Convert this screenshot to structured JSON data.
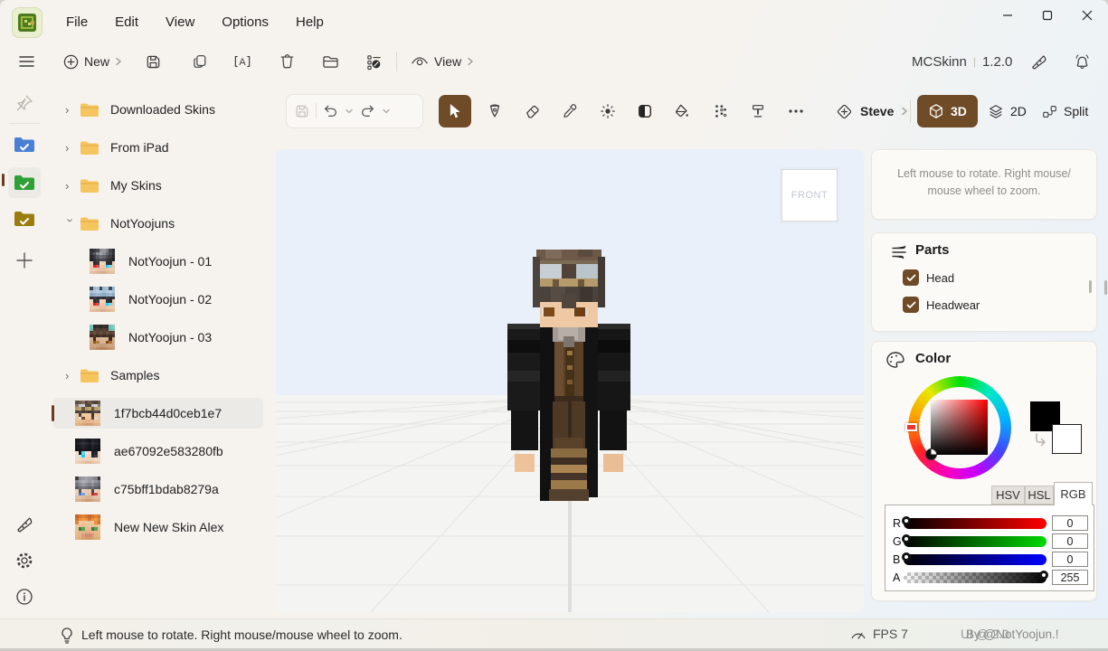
{
  "window": {
    "title": "MCSkinn",
    "title_sep": "|",
    "version": "1.2.0"
  },
  "menu": {
    "items": [
      "File",
      "Edit",
      "View",
      "Options",
      "Help"
    ]
  },
  "toolbar": {
    "new_label": "New",
    "view_label": "View"
  },
  "editor": {
    "model_label": "Steve",
    "mode_3d": "3D",
    "mode_2d": "2D",
    "mode_split": "Split"
  },
  "viewport": {
    "front_label": "FRONT"
  },
  "panels": {
    "tip": "Left mouse to rotate. Right mouse/ mouse wheel to zoom.",
    "parts": {
      "title": "Parts",
      "items": [
        {
          "label": "Head",
          "checked": true
        },
        {
          "label": "Headwear",
          "checked": true
        }
      ]
    },
    "color": {
      "title": "Color",
      "tabs": [
        "HSV",
        "HSL",
        "RGB"
      ],
      "active_tab": "RGB",
      "channels": [
        {
          "label": "R",
          "value": "0",
          "track": "tr-r",
          "thumb_at_end": false
        },
        {
          "label": "G",
          "value": "0",
          "track": "tr-g",
          "thumb_at_end": false
        },
        {
          "label": "B",
          "value": "0",
          "track": "tr-b",
          "thumb_at_end": false
        },
        {
          "label": "A",
          "value": "255",
          "track": "tr-a",
          "thumb_at_end": true
        }
      ],
      "primary_swatch": "#000000",
      "secondary_swatch": "#ffffff"
    }
  },
  "status": {
    "tip": "Left mouse to rotate. Right mouse/mouse wheel to zoom.",
    "fps_label": "FPS",
    "fps_value": "7",
    "credit_back": "UI @ 2.0",
    "credit_front": "By @NotYoojun.!"
  },
  "colors": {
    "accent_brown": "#6f4b27",
    "folder_yellow": "#f5c65f",
    "folder_tab": "#e8b04a",
    "rail_blue": "#4b7fd6",
    "rail_green": "#2fa035",
    "rail_olive": "#9a7d0e",
    "sky": "#e9f0f9",
    "floor": "#f4f4f2",
    "selection_bg": "#eceae6",
    "selection_bar": "#6b3a20"
  },
  "tree": {
    "rows": [
      {
        "kind": "folder",
        "label": "Downloaded Skins",
        "expanded": false
      },
      {
        "kind": "folder",
        "label": "From iPad",
        "expanded": false
      },
      {
        "kind": "folder",
        "label": "My Skins",
        "expanded": false
      },
      {
        "kind": "folder",
        "label": "NotYoojuns",
        "expanded": true
      },
      {
        "kind": "skin",
        "label": "NotYoojun - 01",
        "thumb": "t01",
        "child": true
      },
      {
        "kind": "skin",
        "label": "NotYoojun - 02",
        "thumb": "t02",
        "child": true
      },
      {
        "kind": "skin",
        "label": "NotYoojun - 03",
        "thumb": "t03",
        "child": true
      },
      {
        "kind": "folder",
        "label": "Samples",
        "expanded": false
      },
      {
        "kind": "skin",
        "label": "1f7bcb44d0ceb1e7",
        "thumb": "t1f",
        "selected": true
      },
      {
        "kind": "skin",
        "label": "ae67092e583280fb",
        "thumb": "tae"
      },
      {
        "kind": "skin",
        "label": "c75bff1bdab8279a",
        "thumb": "tc7"
      },
      {
        "kind": "skin",
        "label": "New New Skin Alex",
        "thumb": "tal"
      }
    ]
  },
  "thumbs": {
    "t01": [
      "#2f2f33 #3b3b3f #4a4a4e #8d8d93 #9a9aa1 #7e7e85 #44444a #2c2c30",
      "#3a3a3e #55555b #8a8a91 #a3a3ab #8f8f97 #6b6b73 #4c4c52 #333337",
      "#2b2b2f #3e3e44 #5a5a61 #72727a #63636b #4e4e55 #3a3a40 #292a2e",
      "#232327 #2f2f35 #3f3f46 #4c4c53 #45454c #38383f #2d2d33 #212125",
      "#f0d7bd #2e2e32 #3a3a3e #f0d7bd #edd2b8 #323236 #2c2c30 #eccfb5",
      "#eecfb4 #c22f2f #e04545 #eecfb4 #e9c9ae #35c4ee #6fdcf7 #e6c5aa",
      "#ecccb0 #ecccb0 #e8c6aa #e5c2a6 #e5c2a6 #e8c6aa #ecccb0 #ecccb0",
      "#e5c0a2 #e2bc9e #deb698 #d8ae90 #d8ae90 #deb698 #e2bc9e #e5c0a2"
    ],
    "t02": [
      "#3c4454 #9db7cf #a8c2d8 #3e4656 #9db7cf #a8c2d8 #424a5a #9db7cf",
      "#a9c3d9 #b2cade #bcd2e4 #b2cade #a9c3d9 #b2cade #bcd2e4 #a9c3d9",
      "#8fa9c0 #97b1c8 #9fb9d0 #97b1c8 #8fa9c0 #97b1c8 #9fb9d0 #8fa9c0",
      "#2e2e34 #3a3a42 #2e2e34 #363640 #2e2e34 #3a3a42 #2e2e34 #363640",
      "#f0d7bd #2e2e32 #3a3a3e #f0d7bd #edd2b8 #323236 #2c2c30 #eccfb5",
      "#eecfb4 #c22f2f #e04545 #eecfb4 #e9c9ae #35c4ee #6fdcf7 #e6c5aa",
      "#ecccb0 #ecccb0 #e8c6aa #e5c2a6 #e5c2a6 #e8c6aa #ecccb0 #ecccb0",
      "#e5c0a2 #e2bc9e #deb698 #d8ae90 #d8ae90 #deb698 #e2bc9e #e5c0a2"
    ],
    "t03": [
      "#77c2ba #2e2a28 #353028 #2b2724 #353028 #2e2a28 #77c2ba #82ccc4",
      "#6fbcb4 #4a3a30 #554438 #4a3a30 #554438 #4a3a30 #6fbcb4 #77c2ba",
      "#5a4334 #6a4f3c #5a4334 #6a4f3c #5a4334 #6a4f3c #5a4334 #64493a",
      "#3c2c22 #49382a #3c2c22 #49382a #3c2c22 #49382a #3c2c22 #44332a",
      "#d9b292 #3a2c24 #d9b292 #ddb898 #ddb898 #d9b292 #3a2c24 #d5ac8c",
      "#d5ac8c #8a5a2a #b67a3a #d9b292 #d9b292 #7a4a22 #a86e34 #d1a686",
      "#cfa483 #cfa483 #cba07e #c79a78 #c79a78 #cba07e #cfa483 #cfa483",
      "#c79a78 #c3946f #bd8c66 #b7845e #b7845e #bd8c66 #c3946f #c79a78"
    ],
    "t1f": [
      "#5d4c3e #6d5a4a #7d6a58 #55463c #6d5a4a #5d4c3e #4d4038 #6d5a4a",
      "#8a7a66 #c3ccd2 #cdd4da #5a4a3e #514239 #c3ccd2 #cdd4da #8a7a66",
      "#b59b6c #bfa576 #6f5839 #b59b6c #bfa576 #6f5839 #b59b6c #bfa576",
      "#4a423b #564c44 #4a423b #51463d #3d3631 #4a423b #564c44 #4a423b",
      "#efc9a3 #4a423b #efc9a3 #efc9a3 #efc9a3 #3d3631 #efc9a3 #efc9a3",
      "#ecc49c #e0e0e0 #7c4a1a #ecc49c #ecc49c #6e3f15 #d8d8d8 #ecc49c",
      "#e9bf96 #e9bf96 #e5b990 #e2b48a #e2b48a #e5b990 #e9bf96 #e9bf96",
      "#e2b48a #deae84 #d8a67c #d29e74 #d29e74 #d8a67c #deae84 #e2b48a"
    ],
    "tae": [
      "#17171b #1d1d23 #26262e #1d1d23 #17171b #22222a #1d1d23 #17171b",
      "#1d1d23 #2a2a32 #34343e #2a2a32 #22222a #2e2e38 #26262e #1d1d23",
      "#15151a #1d1d23 #26262e #1d1d23 #17171b #22222a #1a1a20 #141419",
      "#111116 #17171b #1d1d23 #1a1a20 #15151a #1a1a20 #15151a #101014",
      "#f4e0cc #17171b #60d8f2 #f4e0cc #f2dcc6 #1d1d23 #26262e #f0d8c2",
      "#f2dcc6 #aef0fc #38c0e8 #f2dcc6 #eed4bc #26262e #3a3a44 #ecd0b8",
      "#f0d8c2 #f0d8c2 #eed4bc #ecd0b8 #ecd0b8 #eed4bc #f0d8c2 #f0d8c2",
      "#ecd0b8 #e9cab0 #e5c2a6 #e0ba9c #e0ba9c #e5c2a6 #e9cab0 #ecd0b8"
    ],
    "tc7": [
      "#453e3e #8f8f97 #9a9aa1 #a3a3ab #9a9aa1 #8f8f97 #857f83 #3d3738",
      "#8a8a91 #9fa0a8 #b0b0b8 #a8a8b0 #9a9aa1 #a8a8b0 #9298a0 #7e7e85",
      "#75757d #8a8a91 #9a9aa1 #8f8f97 #82828a #8f8f97 #7a7a82 #6b6b73",
      "#5a5a61 #6b6b73 #75757d #6f6f77 #63636b #6f6f77 #5e5e66 #525259",
      "#ecd0b8 #55555b #ecd0b8 #e9cab0 #e9cab0 #4c4c52 #ecd0b8 #e9cab0",
      "#e9cab0 #4878d8 #7aa0e8 #e9cab0 #e5c2a6 #b03030 #d04848 #e5c2a6",
      "#e5c2a6 #e5c2a6 #e0ba9c #dcb294 #dcb294 #e0ba9c #e5c2a6 #e5c2a6",
      "#dcb294 #d8ac8c #d2a482 #cc9c78 #cc9c78 #d2a482 #d8ac8c #dcb294"
    ],
    "tal": [
      "#c9642a #d8742f #e08438 #d8742f #c9642a #d8742f #e08438 #d8742f",
      "#d8742f #e8903e #f09c46 #e8903e #d8742f #e8903e #f09c46 #e08438",
      "#e08438 #f0c9a2 #eec49c #f0c9a2 #eec49c #f0c9a2 #e8903e #d8742f",
      "#eec49c #ecc096 #eabc90 #ecc096 #eec49c #ecc096 #eabc90 #eec49c",
      "#ecc096 #3a7a3a #5aa05a #eabc90 #e8b88a #3a7a3a #5aa05a #eabc90",
      "#eabc90 #e8b88a #e5b484 #e2b07e #e2b07e #e5b484 #e8b88a #eabc90",
      "#e8b88a #e5b484 #d89a80 #d08c74 #d08c74 #d89a80 #e5b484 #e8b88a",
      "#e2b07e #deaa76 #d8a26e #d29a66 #d29a66 #d8a26e #deaa76 #e2b07e"
    ]
  },
  "character": {
    "blocks": [
      [
        6,
        88,
        36,
        96,
        "#1a1a1a"
      ],
      [
        106,
        88,
        36,
        96,
        "#161616"
      ],
      [
        6,
        88,
        36,
        6,
        "#2e2e2e"
      ],
      [
        106,
        88,
        36,
        6,
        "#2a2a2a"
      ],
      [
        6,
        106,
        36,
        14,
        "#0e0e0e"
      ],
      [
        106,
        106,
        36,
        14,
        "#0c0c0c"
      ],
      [
        6,
        140,
        36,
        12,
        "#262626"
      ],
      [
        106,
        140,
        36,
        12,
        "#222222"
      ],
      [
        10,
        184,
        30,
        44,
        "#141414"
      ],
      [
        108,
        184,
        30,
        44,
        "#121212"
      ],
      [
        14,
        232,
        22,
        20,
        "#eec39c"
      ],
      [
        112,
        232,
        22,
        20,
        "#e9bd96"
      ],
      [
        42,
        90,
        16,
        194,
        "#111111"
      ],
      [
        90,
        90,
        16,
        190,
        "#131313"
      ],
      [
        58,
        108,
        32,
        66,
        "#5c4129"
      ],
      [
        58,
        108,
        10,
        66,
        "#6b4d31"
      ],
      [
        70,
        108,
        10,
        66,
        "#473018"
      ],
      [
        72,
        118,
        6,
        5,
        "#9b7743"
      ],
      [
        72,
        134,
        6,
        5,
        "#8b6839"
      ],
      [
        72,
        150,
        6,
        5,
        "#7b5a31"
      ],
      [
        58,
        168,
        32,
        10,
        "#3c2b1d"
      ],
      [
        56,
        174,
        36,
        52,
        "#4e3926"
      ],
      [
        73,
        174,
        4,
        52,
        "#38291b"
      ],
      [
        58,
        214,
        32,
        14,
        "#5a4129"
      ],
      [
        54,
        226,
        40,
        10,
        "#8a6c42"
      ],
      [
        54,
        236,
        40,
        8,
        "#3f2f22"
      ],
      [
        54,
        244,
        40,
        9,
        "#ab8451"
      ],
      [
        54,
        253,
        40,
        8,
        "#46342a"
      ],
      [
        54,
        261,
        40,
        10,
        "#9c7a4a"
      ],
      [
        52,
        271,
        44,
        13,
        "#53402e"
      ],
      [
        56,
        86,
        36,
        22,
        "#a39b94"
      ],
      [
        62,
        92,
        22,
        14,
        "#b7afa7"
      ],
      [
        68,
        102,
        12,
        12,
        "#7d756e"
      ],
      [
        38,
        6,
        72,
        16,
        "#6e5948"
      ],
      [
        48,
        6,
        18,
        10,
        "#7e6b59"
      ],
      [
        84,
        6,
        16,
        8,
        "#5b4a3e"
      ],
      [
        34,
        14,
        8,
        56,
        "#4b433d"
      ],
      [
        106,
        14,
        8,
        56,
        "#423b35"
      ],
      [
        42,
        18,
        64,
        4,
        "#7c6b57"
      ],
      [
        42,
        22,
        26,
        16,
        "#c7cfd5"
      ],
      [
        80,
        22,
        26,
        16,
        "#bac4cb"
      ],
      [
        66,
        22,
        16,
        16,
        "#514239"
      ],
      [
        42,
        38,
        64,
        9,
        "#b59b6c"
      ],
      [
        56,
        39,
        7,
        8,
        "#6f5839"
      ],
      [
        84,
        39,
        7,
        8,
        "#6f5839"
      ],
      [
        42,
        47,
        64,
        22,
        "#4a423b"
      ],
      [
        54,
        47,
        16,
        24,
        "#564c44"
      ],
      [
        86,
        47,
        14,
        18,
        "#3d3631"
      ],
      [
        42,
        64,
        64,
        28,
        "#efc9a3"
      ],
      [
        66,
        55,
        16,
        16,
        "#51463d"
      ],
      [
        44,
        70,
        3,
        10,
        "#e0e0e0"
      ],
      [
        46,
        70,
        12,
        10,
        "#7c4a1a"
      ],
      [
        80,
        70,
        12,
        10,
        "#6e3f15"
      ],
      [
        92,
        70,
        3,
        10,
        "#d8d8d8"
      ]
    ]
  }
}
